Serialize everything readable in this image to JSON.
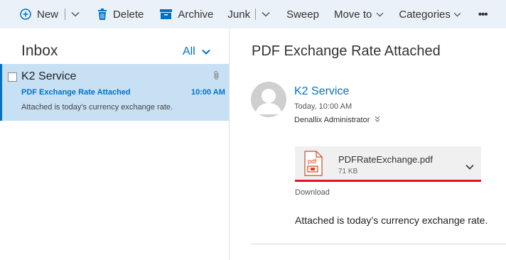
{
  "toolbar": {
    "new_label": "New",
    "delete_label": "Delete",
    "archive_label": "Archive",
    "junk_label": "Junk",
    "sweep_label": "Sweep",
    "move_to_label": "Move to",
    "categories_label": "Categories",
    "more_label": "•••"
  },
  "folder": {
    "title": "Inbox",
    "filter_label": "All"
  },
  "messages": [
    {
      "sender": "K2 Service",
      "subject": "PDF Exchange Rate Attached",
      "time": "10:00 AM",
      "preview": "Attached is today's currency exchange rate."
    }
  ],
  "reading": {
    "subject": "PDF Exchange Rate Attached",
    "from_name": "K2 Service",
    "date": "Today, 10:00 AM",
    "to": "Denallix Administrator",
    "attachment": {
      "name": "PDFRateExchange.pdf",
      "size": "71 KB",
      "icon_label": "pdf"
    },
    "download_label": "Download",
    "body": "Attached is today’s currency exchange rate."
  },
  "colors": {
    "accent": "#0072c6",
    "toolbar_bg": "#eaf1f8",
    "selected_bg": "#c7e0f4",
    "attachment_underline": "#e81123",
    "pdf_icon": "#d24726"
  },
  "icons": [
    "plus-circle-icon",
    "chevron-down-icon",
    "trash-icon",
    "archive-icon",
    "paperclip-icon",
    "avatar-silhouette-icon",
    "double-chevron-icon",
    "pdf-file-icon"
  ]
}
